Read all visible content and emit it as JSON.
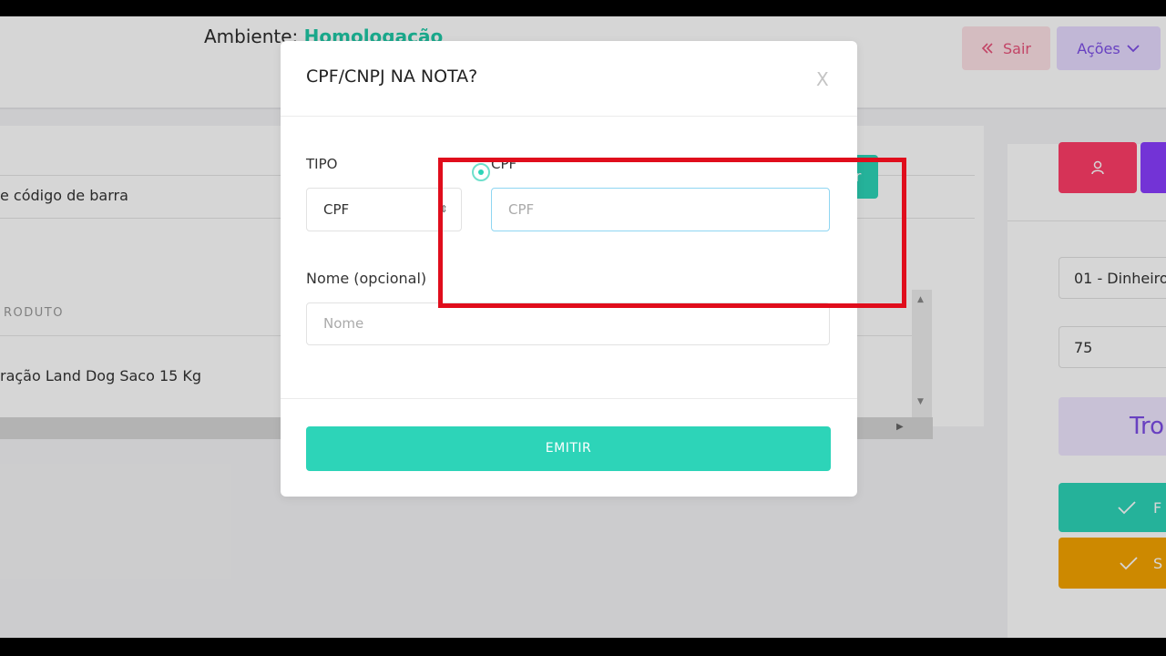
{
  "header": {
    "env_label": "Ambiente: ",
    "env_value": "Homologação",
    "sair_label": "Sair",
    "sair_icon": "double-chevron-left-icon",
    "acoes_label": "Ações",
    "acoes_icon": "chevron-down-icon"
  },
  "search": {
    "barcode_text": "e código de barra",
    "side_button_label": "r"
  },
  "product_table": {
    "columns": [
      "RODUTO"
    ],
    "rows": [
      [
        "ração Land Dog Saco 15 Kg"
      ]
    ]
  },
  "right_panel": {
    "user_icon": "user-icon",
    "payment_method": "01 - Dinheiro",
    "amount_value": "75",
    "troco_label": "Tro",
    "green_button_label": "F",
    "orange_button_label": "S",
    "check_icon": "check-icon"
  },
  "modal": {
    "title": "CPF/CNPJ NA NOTA?",
    "close_label": "X",
    "tipo_label": "TIPO",
    "tipo_value": "CPF",
    "cpf_label": "CPF",
    "cpf_placeholder": "CPF",
    "nome_label": "Nome (opcional)",
    "nome_placeholder": "Nome",
    "emitir_label": "EMITIR"
  },
  "colors": {
    "accent_green": "#2dd4b8",
    "purple": "#7c4de6",
    "highlight_red": "#e00d1c"
  }
}
